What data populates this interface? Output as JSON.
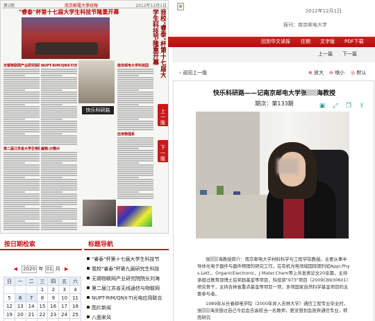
{
  "newspaper": {
    "masthead_left": "第2期",
    "masthead_center": "南京郵電大學校報",
    "masthead_right": "2012年12月1日",
    "headline": "\"睿泰\"杯第十七届大学生科技节隆重开幕",
    "side_headline": "我校\"睿泰\"杯第十七届大学生科技节隆重开幕",
    "box_header": "快乐科研路",
    "columns": [
      {
        "heads": [
          "无锡物联网产业研究院院长刘海涛",
          "第二届江苏省大学生物联网创新创业大赛"
        ]
      },
      {
        "heads": [
          "NUPT-RIM/QNX-TI光电应用联合实验室",
          "编辑:沙豫兴"
        ]
      },
      {
        "heads": [
          "南京邮电大学科技园",
          "应用物理系"
        ]
      },
      {
        "heads": [
          "水木年华",
          "教育部关于公布第九批"
        ]
      }
    ]
  },
  "page_tabs": {
    "up": "上一版",
    "down": "下一版"
  },
  "date_panel": {
    "title": "按日期检索",
    "year": "2020",
    "year_unit": "年",
    "month": "01",
    "month_unit": "月",
    "prev_arrow": "◀",
    "next_arrow": "▶",
    "weekdays": [
      "日",
      "一",
      "二",
      "三",
      "四",
      "五",
      "六"
    ],
    "weeks": [
      [
        "",
        "",
        "",
        "1",
        "2",
        "3",
        "4"
      ],
      [
        "5",
        "6",
        "7",
        "8",
        "9",
        "10",
        "11"
      ],
      [
        "12",
        "13",
        "14",
        "15",
        "16",
        "17",
        "18"
      ],
      [
        "19",
        "20",
        "21",
        "22",
        "23",
        "24",
        "25"
      ],
      [
        "26",
        "27",
        "28",
        "29",
        "30",
        "31",
        ""
      ]
    ],
    "highlight_days": [
      "6",
      "7"
    ]
  },
  "nav_panel": {
    "title": "标题导航",
    "items": [
      "\"睿泰\"杯第十七届大学生科技节",
      "我校\"睿泰\"杯第九届研究生科技",
      "无锡物联网产业研究院院长刘海",
      "第二届江苏省无线通信与物联网",
      "NUPT-RIM/QNX-TI光电应用联合",
      "图片新闻",
      "八面来风"
    ]
  },
  "right_header": {
    "date": "2012年12月1日",
    "publisher_label": "报刊：",
    "publisher": "南京邮电大学",
    "links": [
      "回到华文读报",
      "往期",
      "文字版",
      "PDF下载"
    ],
    "prev_label": "上一篇",
    "next_label": "下一篇"
  },
  "article_toolbar": {
    "back_label": "返回上一版",
    "zoom_in": "放大",
    "zoom_out": "缩小",
    "default": "默认"
  },
  "article": {
    "title_part1": "快乐科研路——记南京邮电大学张",
    "title_part2": "海教授",
    "issue": "期次：第133期",
    "icons": [
      "bookmark-icon",
      "fullscreen-icon",
      "copy-icon",
      "share-icon",
      "settings-icon"
    ],
    "para1_part1": "张",
    "para1_part2": "海教授简介：南京邮电大学材料科学与工程学院教授。主要从事半导体光电子器件与器件物理的研究工作，在有机光电领域国际期刊如Appl.Phys.Lett.、OrganicElectronic、J.Mater.Chem等上共发表论文20余篇，主持承担过教育部博士后奖励基金等项目，科技部\"973\"项目（2009CB930601）研究骨干，主持吉林省重点基金等项目一项，多项国家自然科学基金项目的主要参与者。",
    "para2_part1": "1989年从长春邮电学院（2000年并入吉林大学）通信工程专业毕业时，张",
    "para2_part2": "海没想过自己今后会去高校当一名教师，更没想到会放弃通信专业，转而研究"
  },
  "colors": {
    "accent_red": "#c8141e",
    "icon_teal": "#2a9d8f",
    "calendar_header": "#e8eef5"
  }
}
